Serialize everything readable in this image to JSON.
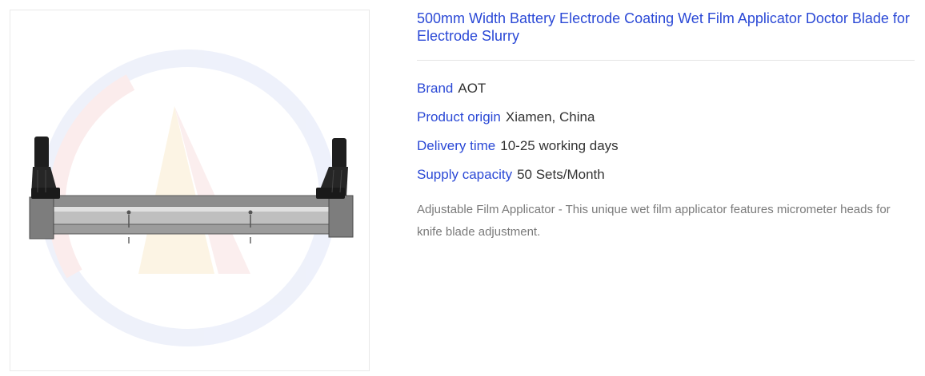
{
  "product": {
    "title": "500mm Width Battery Electrode Coating Wet Film Applicator Doctor Blade for Electrode Slurry",
    "image_alt": "Wet film applicator doctor blade with two micrometer heads",
    "specs": [
      {
        "label": "Brand",
        "value": "AOT"
      },
      {
        "label": "Product origin",
        "value": "Xiamen, China"
      },
      {
        "label": "Delivery time",
        "value": "10-25 working days"
      },
      {
        "label": "Supply capacity",
        "value": "50 Sets/Month"
      }
    ],
    "description": "Adjustable Film Applicator - This unique wet film applicator features micrometer heads for knife blade adjustment."
  },
  "colors": {
    "link_blue": "#2b49d6",
    "value_text": "#333333",
    "description_text": "#7a7a7a"
  }
}
